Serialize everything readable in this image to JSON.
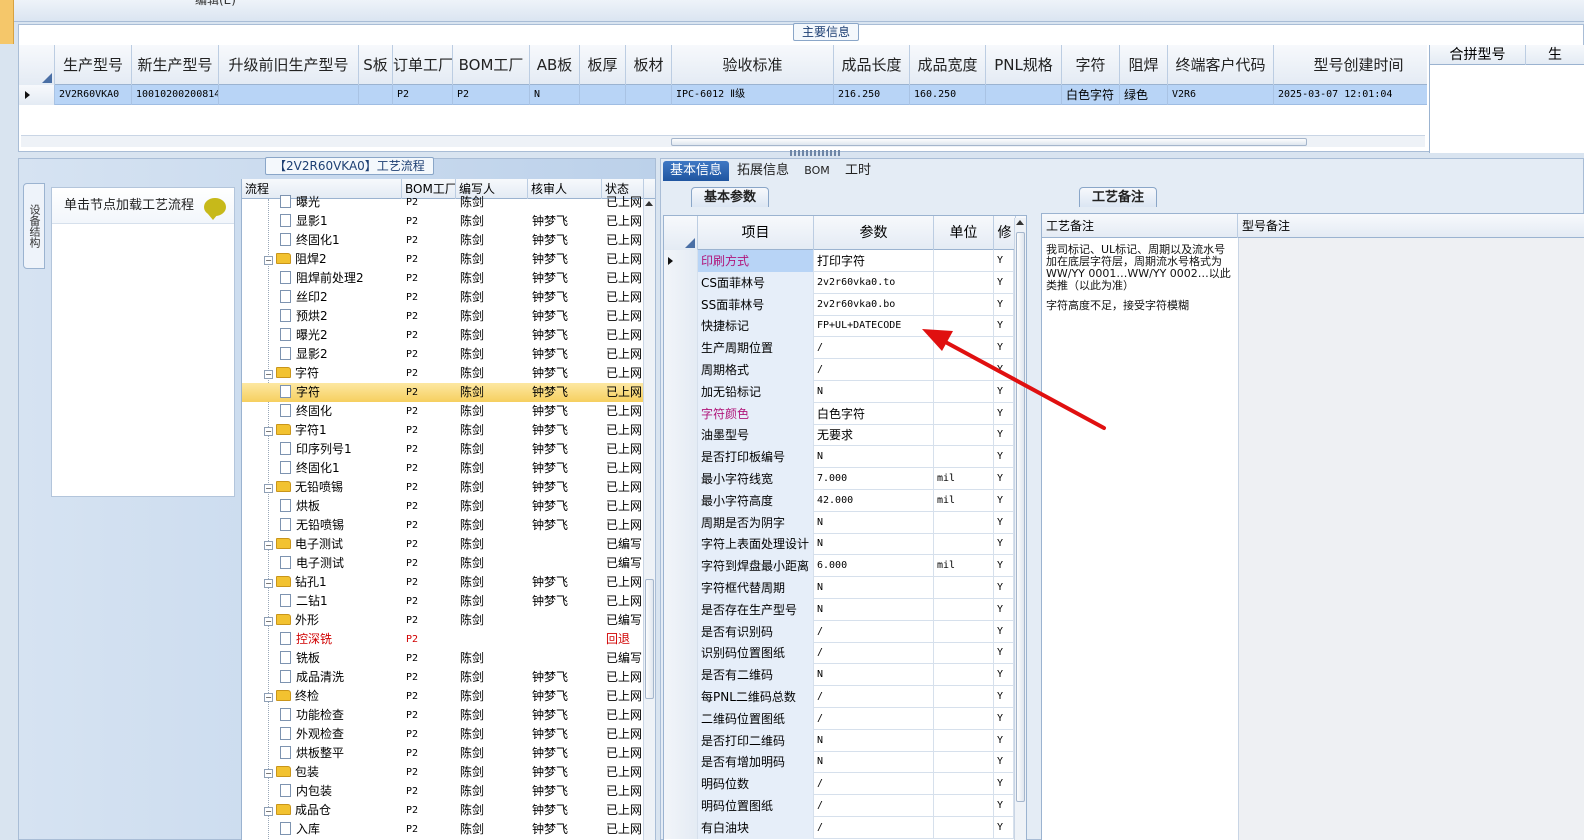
{
  "window": {
    "top_text": "编辑(E)"
  },
  "main_info": {
    "title": "主要信息",
    "columns": [
      "生产型号",
      "新生产型号",
      "升级前旧生产型号",
      "S板",
      "订单工厂",
      "BOM工厂",
      "AB板",
      "板厚",
      "板材",
      "验收标准",
      "成品长度",
      "成品宽度",
      "PNL规格",
      "字符",
      "阻焊",
      "终端客户代码",
      "型号创建时间"
    ],
    "row": [
      "2V2R60VKA0",
      "10010200200814",
      "",
      "",
      "P2",
      "P2",
      "N",
      "",
      "",
      "IPC-6012 Ⅱ级",
      "216.250",
      "160.250",
      "",
      "白色字符",
      "绿色",
      "V2R6",
      "2025-03-07 12:01:04"
    ],
    "side_columns": [
      "合拼型号",
      "生"
    ]
  },
  "flow_panel": {
    "title": "【2V2R60VKA0】工艺流程",
    "vertical_tab": "设备结构",
    "hint": "单击节点加载工艺流程",
    "columns": [
      "流程",
      "BOM工厂",
      "编写人",
      "核审人",
      "状态"
    ],
    "rows": [
      {
        "name": "曝光",
        "bom": "P2",
        "writer": "陈剑",
        "reviewer": "",
        "status": "已上网",
        "level": 2
      },
      {
        "name": "显影1",
        "bom": "P2",
        "writer": "陈剑",
        "reviewer": "钟梦飞",
        "status": "已上网",
        "level": 2
      },
      {
        "name": "终固化1",
        "bom": "P2",
        "writer": "陈剑",
        "reviewer": "钟梦飞",
        "status": "已上网",
        "level": 2
      },
      {
        "name": "阻焊2",
        "bom": "P2",
        "writer": "陈剑",
        "reviewer": "钟梦飞",
        "status": "已上网",
        "level": 1
      },
      {
        "name": "阻焊前处理2",
        "bom": "P2",
        "writer": "陈剑",
        "reviewer": "钟梦飞",
        "status": "已上网",
        "level": 2
      },
      {
        "name": "丝印2",
        "bom": "P2",
        "writer": "陈剑",
        "reviewer": "钟梦飞",
        "status": "已上网",
        "level": 2
      },
      {
        "name": "预烘2",
        "bom": "P2",
        "writer": "陈剑",
        "reviewer": "钟梦飞",
        "status": "已上网",
        "level": 2
      },
      {
        "name": "曝光2",
        "bom": "P2",
        "writer": "陈剑",
        "reviewer": "钟梦飞",
        "status": "已上网",
        "level": 2
      },
      {
        "name": "显影2",
        "bom": "P2",
        "writer": "陈剑",
        "reviewer": "钟梦飞",
        "status": "已上网",
        "level": 2
      },
      {
        "name": "字符",
        "bom": "P2",
        "writer": "陈剑",
        "reviewer": "钟梦飞",
        "status": "已上网",
        "level": 1
      },
      {
        "name": "字符",
        "bom": "P2",
        "writer": "陈剑",
        "reviewer": "钟梦飞",
        "status": "已上网",
        "level": 2,
        "selected": true
      },
      {
        "name": "终固化",
        "bom": "P2",
        "writer": "陈剑",
        "reviewer": "钟梦飞",
        "status": "已上网",
        "level": 2
      },
      {
        "name": "字符1",
        "bom": "P2",
        "writer": "陈剑",
        "reviewer": "钟梦飞",
        "status": "已上网",
        "level": 1
      },
      {
        "name": "印序列号1",
        "bom": "P2",
        "writer": "陈剑",
        "reviewer": "钟梦飞",
        "status": "已上网",
        "level": 2
      },
      {
        "name": "终固化1",
        "bom": "P2",
        "writer": "陈剑",
        "reviewer": "钟梦飞",
        "status": "已上网",
        "level": 2
      },
      {
        "name": "无铅喷锡",
        "bom": "P2",
        "writer": "陈剑",
        "reviewer": "钟梦飞",
        "status": "已上网",
        "level": 1
      },
      {
        "name": "烘板",
        "bom": "P2",
        "writer": "陈剑",
        "reviewer": "钟梦飞",
        "status": "已上网",
        "level": 2
      },
      {
        "name": "无铅喷锡",
        "bom": "P2",
        "writer": "陈剑",
        "reviewer": "钟梦飞",
        "status": "已上网",
        "level": 2
      },
      {
        "name": "电子测试",
        "bom": "P2",
        "writer": "陈剑",
        "reviewer": "",
        "status": "已编写",
        "level": 1
      },
      {
        "name": "电子测试",
        "bom": "P2",
        "writer": "陈剑",
        "reviewer": "",
        "status": "已编写",
        "level": 2
      },
      {
        "name": "钻孔1",
        "bom": "P2",
        "writer": "陈剑",
        "reviewer": "钟梦飞",
        "status": "已上网",
        "level": 1
      },
      {
        "name": "二钻1",
        "bom": "P2",
        "writer": "陈剑",
        "reviewer": "钟梦飞",
        "status": "已上网",
        "level": 2
      },
      {
        "name": "外形",
        "bom": "P2",
        "writer": "陈剑",
        "reviewer": "",
        "status": "已编写",
        "level": 1
      },
      {
        "name": "控深铣",
        "bom": "P2",
        "writer": "",
        "reviewer": "",
        "status": "回退",
        "level": 2,
        "red": true
      },
      {
        "name": "铣板",
        "bom": "P2",
        "writer": "陈剑",
        "reviewer": "",
        "status": "已编写",
        "level": 2
      },
      {
        "name": "成品清洗",
        "bom": "P2",
        "writer": "陈剑",
        "reviewer": "钟梦飞",
        "status": "已上网",
        "level": 2
      },
      {
        "name": "终检",
        "bom": "P2",
        "writer": "陈剑",
        "reviewer": "钟梦飞",
        "status": "已上网",
        "level": 1
      },
      {
        "name": "功能检查",
        "bom": "P2",
        "writer": "陈剑",
        "reviewer": "钟梦飞",
        "status": "已上网",
        "level": 2
      },
      {
        "name": "外观检查",
        "bom": "P2",
        "writer": "陈剑",
        "reviewer": "钟梦飞",
        "status": "已上网",
        "level": 2
      },
      {
        "name": "烘板整平",
        "bom": "P2",
        "writer": "陈剑",
        "reviewer": "钟梦飞",
        "status": "已上网",
        "level": 2
      },
      {
        "name": "包装",
        "bom": "P2",
        "writer": "陈剑",
        "reviewer": "钟梦飞",
        "status": "已上网",
        "level": 1
      },
      {
        "name": "内包装",
        "bom": "P2",
        "writer": "陈剑",
        "reviewer": "钟梦飞",
        "status": "已上网",
        "level": 2
      },
      {
        "name": "成品仓",
        "bom": "P2",
        "writer": "陈剑",
        "reviewer": "钟梦飞",
        "status": "已上网",
        "level": 1
      },
      {
        "name": "入库",
        "bom": "P2",
        "writer": "陈剑",
        "reviewer": "钟梦飞",
        "status": "已上网",
        "level": 2
      }
    ]
  },
  "detail": {
    "tabs": [
      "基本信息",
      "拓展信息",
      "BOM",
      "工时"
    ],
    "subtab": "基本参数",
    "param_columns": [
      "项目",
      "参数",
      "单位",
      "修"
    ],
    "params": [
      {
        "item": "印刷方式",
        "value": "打印字符",
        "unit": "",
        "flag": "Y",
        "pink": true,
        "selected": true
      },
      {
        "item": "CS面菲林号",
        "value": "2v2r60vka0.to",
        "unit": "",
        "flag": "Y"
      },
      {
        "item": "SS面菲林号",
        "value": "2v2r60vka0.bo",
        "unit": "",
        "flag": "Y"
      },
      {
        "item": "快捷标记",
        "value": "FP+UL+DATECODE",
        "unit": "",
        "flag": "Y"
      },
      {
        "item": "生产周期位置",
        "value": "/",
        "unit": "",
        "flag": "Y"
      },
      {
        "item": "周期格式",
        "value": "/",
        "unit": "",
        "flag": "Y"
      },
      {
        "item": "加无铅标记",
        "value": "N",
        "unit": "",
        "flag": "Y"
      },
      {
        "item": "字符颜色",
        "value": "白色字符",
        "unit": "",
        "flag": "Y",
        "pink": true
      },
      {
        "item": "油墨型号",
        "value": "无要求",
        "unit": "",
        "flag": "Y"
      },
      {
        "item": "是否打印板编号",
        "value": "N",
        "unit": "",
        "flag": "Y"
      },
      {
        "item": "最小字符线宽",
        "value": "7.000",
        "unit": "mil",
        "flag": "Y"
      },
      {
        "item": "最小字符高度",
        "value": "42.000",
        "unit": "mil",
        "flag": "Y"
      },
      {
        "item": "周期是否为阴字",
        "value": "N",
        "unit": "",
        "flag": "Y"
      },
      {
        "item": "字符上表面处理设计",
        "value": "N",
        "unit": "",
        "flag": "Y"
      },
      {
        "item": "字符到焊盘最小距离",
        "value": "6.000",
        "unit": "mil",
        "flag": "Y"
      },
      {
        "item": "字符框代替周期",
        "value": "N",
        "unit": "",
        "flag": "Y"
      },
      {
        "item": "是否存在生产型号",
        "value": "N",
        "unit": "",
        "flag": "Y"
      },
      {
        "item": "是否有识别码",
        "value": "/",
        "unit": "",
        "flag": "Y"
      },
      {
        "item": "识别码位置图纸",
        "value": "/",
        "unit": "",
        "flag": "Y"
      },
      {
        "item": "是否有二维码",
        "value": "N",
        "unit": "",
        "flag": "Y"
      },
      {
        "item": "每PNL二维码总数",
        "value": "/",
        "unit": "",
        "flag": "Y"
      },
      {
        "item": "二维码位置图纸",
        "value": "/",
        "unit": "",
        "flag": "Y"
      },
      {
        "item": "是否打印二维码",
        "value": "N",
        "unit": "",
        "flag": "Y"
      },
      {
        "item": "是否有增加明码",
        "value": "N",
        "unit": "",
        "flag": "Y"
      },
      {
        "item": "明码位数",
        "value": "/",
        "unit": "",
        "flag": "Y"
      },
      {
        "item": "明码位置图纸",
        "value": "/",
        "unit": "",
        "flag": "Y"
      },
      {
        "item": "有白油块",
        "value": "/",
        "unit": "",
        "flag": "Y"
      }
    ],
    "remark_tab": "工艺备注",
    "remark_columns": [
      "工艺备注",
      "型号备注"
    ],
    "remark_text_1": "我司标记、UL标记、周期以及流水号加在底层字符层，周期流水号格式为WW/YY 0001…WW/YY 0002…以此类推（以此为准）",
    "remark_text_2": "字符高度不足，接受字符模糊"
  },
  "colors": {
    "selection": "#b8d4f6",
    "tree_selected": "#f6cf5f",
    "tab_active": "#2a62ae",
    "annotation_arrow": "#e01010"
  }
}
